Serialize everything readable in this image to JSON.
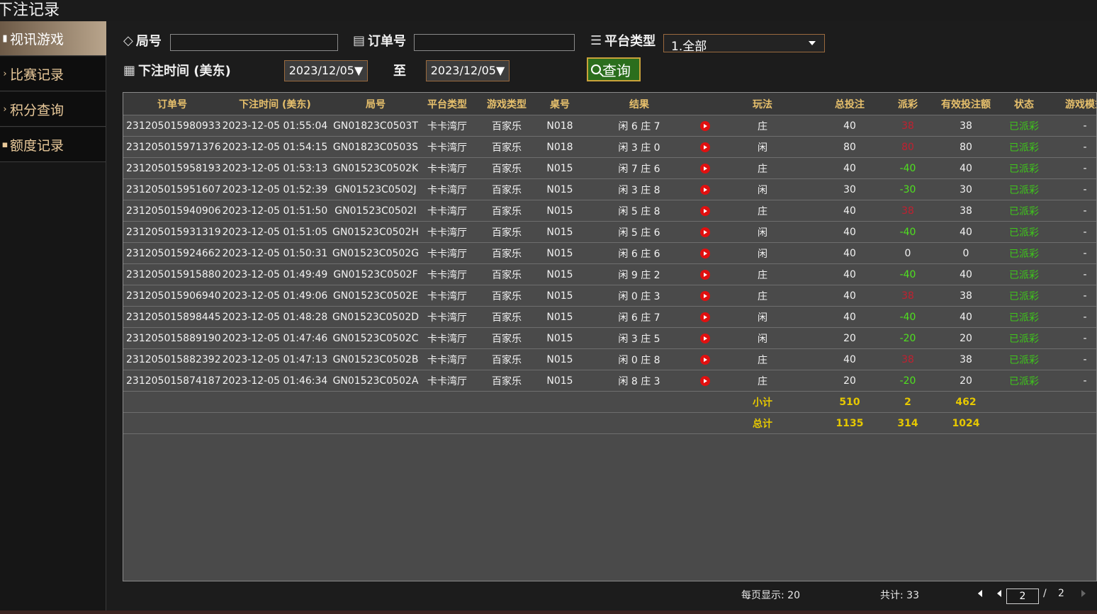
{
  "window": {
    "title": "下注记录"
  },
  "sidebar": {
    "items": [
      {
        "label": "视讯游戏",
        "icon": "phone-icon",
        "active": true
      },
      {
        "label": "比赛记录",
        "icon": "chevron-right-icon",
        "active": false
      },
      {
        "label": "积分查询",
        "icon": "chevron-right-icon",
        "active": false
      },
      {
        "label": "额度记录",
        "icon": "bag-icon",
        "active": false
      }
    ]
  },
  "filters": {
    "round_label": "局号",
    "round_value": "",
    "order_label": "订单号",
    "order_value": "",
    "platform_label": "平台类型",
    "platform_value": "1.全部",
    "time_label": "下注时间 (美东)",
    "date_from": "2023/12/05▼",
    "to_label": "至",
    "date_to": "2023/12/05▼",
    "query_label": "查询"
  },
  "table": {
    "headers": [
      "订单号",
      "下注时间 (美东)",
      "局号",
      "平台类型",
      "游戏类型",
      "桌号",
      "结果",
      "",
      "玩法",
      "总投注",
      "派彩",
      "有效投注额",
      "状态",
      "游戏模式"
    ],
    "rows": [
      {
        "order": "231205015980933",
        "time": "2023-12-05 01:55:04",
        "round": "GN01823C0503T",
        "platform": "卡卡湾厅",
        "game": "百家乐",
        "table": "N018",
        "result": "闲 6 庄 7",
        "play": "庄",
        "bet": "40",
        "payout": "38",
        "payout_sign": "pos",
        "valid": "38",
        "status": "已派彩",
        "mode": "-"
      },
      {
        "order": "231205015971376",
        "time": "2023-12-05 01:54:15",
        "round": "GN01823C0503S",
        "platform": "卡卡湾厅",
        "game": "百家乐",
        "table": "N018",
        "result": "闲 3 庄 0",
        "play": "闲",
        "bet": "80",
        "payout": "80",
        "payout_sign": "pos",
        "valid": "80",
        "status": "已派彩",
        "mode": "-"
      },
      {
        "order": "231205015958193",
        "time": "2023-12-05 01:53:13",
        "round": "GN01523C0502K",
        "platform": "卡卡湾厅",
        "game": "百家乐",
        "table": "N015",
        "result": "闲 7 庄 6",
        "play": "庄",
        "bet": "40",
        "payout": "-40",
        "payout_sign": "neg",
        "valid": "40",
        "status": "已派彩",
        "mode": "-"
      },
      {
        "order": "231205015951607",
        "time": "2023-12-05 01:52:39",
        "round": "GN01523C0502J",
        "platform": "卡卡湾厅",
        "game": "百家乐",
        "table": "N015",
        "result": "闲 3 庄 8",
        "play": "闲",
        "bet": "30",
        "payout": "-30",
        "payout_sign": "neg",
        "valid": "30",
        "status": "已派彩",
        "mode": "-"
      },
      {
        "order": "231205015940906",
        "time": "2023-12-05 01:51:50",
        "round": "GN01523C0502I",
        "platform": "卡卡湾厅",
        "game": "百家乐",
        "table": "N015",
        "result": "闲 5 庄 8",
        "play": "庄",
        "bet": "40",
        "payout": "38",
        "payout_sign": "pos",
        "valid": "38",
        "status": "已派彩",
        "mode": "-"
      },
      {
        "order": "231205015931319",
        "time": "2023-12-05 01:51:05",
        "round": "GN01523C0502H",
        "platform": "卡卡湾厅",
        "game": "百家乐",
        "table": "N015",
        "result": "闲 5 庄 6",
        "play": "闲",
        "bet": "40",
        "payout": "-40",
        "payout_sign": "neg",
        "valid": "40",
        "status": "已派彩",
        "mode": "-"
      },
      {
        "order": "231205015924662",
        "time": "2023-12-05 01:50:31",
        "round": "GN01523C0502G",
        "platform": "卡卡湾厅",
        "game": "百家乐",
        "table": "N015",
        "result": "闲 6 庄 6",
        "play": "闲",
        "bet": "40",
        "payout": "0",
        "payout_sign": "zero",
        "valid": "0",
        "status": "已派彩",
        "mode": "-"
      },
      {
        "order": "231205015915880",
        "time": "2023-12-05 01:49:49",
        "round": "GN01523C0502F",
        "platform": "卡卡湾厅",
        "game": "百家乐",
        "table": "N015",
        "result": "闲 9 庄 2",
        "play": "庄",
        "bet": "40",
        "payout": "-40",
        "payout_sign": "neg",
        "valid": "40",
        "status": "已派彩",
        "mode": "-"
      },
      {
        "order": "231205015906940",
        "time": "2023-12-05 01:49:06",
        "round": "GN01523C0502E",
        "platform": "卡卡湾厅",
        "game": "百家乐",
        "table": "N015",
        "result": "闲 0 庄 3",
        "play": "庄",
        "bet": "40",
        "payout": "38",
        "payout_sign": "pos",
        "valid": "38",
        "status": "已派彩",
        "mode": "-"
      },
      {
        "order": "231205015898445",
        "time": "2023-12-05 01:48:28",
        "round": "GN01523C0502D",
        "platform": "卡卡湾厅",
        "game": "百家乐",
        "table": "N015",
        "result": "闲 6 庄 7",
        "play": "闲",
        "bet": "40",
        "payout": "-40",
        "payout_sign": "neg",
        "valid": "40",
        "status": "已派彩",
        "mode": "-"
      },
      {
        "order": "231205015889190",
        "time": "2023-12-05 01:47:46",
        "round": "GN01523C0502C",
        "platform": "卡卡湾厅",
        "game": "百家乐",
        "table": "N015",
        "result": "闲 3 庄 5",
        "play": "闲",
        "bet": "20",
        "payout": "-20",
        "payout_sign": "neg",
        "valid": "20",
        "status": "已派彩",
        "mode": "-"
      },
      {
        "order": "231205015882392",
        "time": "2023-12-05 01:47:13",
        "round": "GN01523C0502B",
        "platform": "卡卡湾厅",
        "game": "百家乐",
        "table": "N015",
        "result": "闲 0 庄 8",
        "play": "庄",
        "bet": "40",
        "payout": "38",
        "payout_sign": "pos",
        "valid": "38",
        "status": "已派彩",
        "mode": "-"
      },
      {
        "order": "231205015874187",
        "time": "2023-12-05 01:46:34",
        "round": "GN01523C0502A",
        "platform": "卡卡湾厅",
        "game": "百家乐",
        "table": "N015",
        "result": "闲 8 庄 3",
        "play": "庄",
        "bet": "20",
        "payout": "-20",
        "payout_sign": "neg",
        "valid": "20",
        "status": "已派彩",
        "mode": "-"
      }
    ],
    "subtotal": {
      "label": "小计",
      "bet": "510",
      "payout": "2",
      "valid": "462"
    },
    "total": {
      "label": "总计",
      "bet": "1135",
      "payout": "314",
      "valid": "1024"
    }
  },
  "pagination": {
    "per_page_label": "每页显示: 20",
    "total_label": "共计: 33",
    "current_page": "2",
    "separator": "/",
    "total_pages": "2"
  },
  "colors": {
    "accent_gold": "#e7c06c",
    "negative_green": "#4fe01f",
    "positive_red": "#c02030",
    "status_green": "#3ec71a",
    "summary_yellow": "#e6c800",
    "query_button": "#2b6e1d"
  }
}
